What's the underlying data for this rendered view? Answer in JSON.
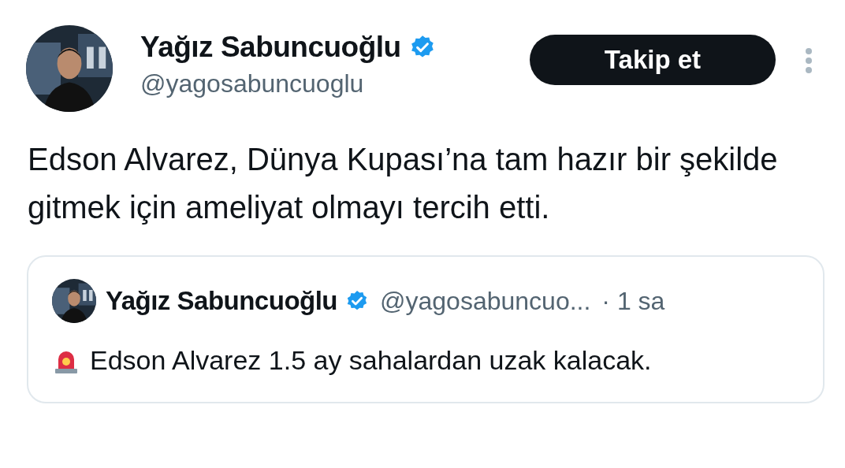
{
  "author": {
    "name": "Yağız Sabuncuoğlu",
    "verified": true,
    "handle": "@yagosabuncuoglu"
  },
  "follow_button": {
    "label": "Takip et"
  },
  "tweet": {
    "text": "Edson Alvarez, Dünya Kupası’na tam hazır bir şekilde gitmek için ameliyat olmayı tercih etti."
  },
  "quoted_tweet": {
    "name": "Yağız Sabuncuoğlu",
    "verified": true,
    "handle": "@yagosabuncuo...",
    "time": "· 1 sa",
    "text": "Edson Alvarez 1.5 ay sahalardan uzak kalacak."
  }
}
